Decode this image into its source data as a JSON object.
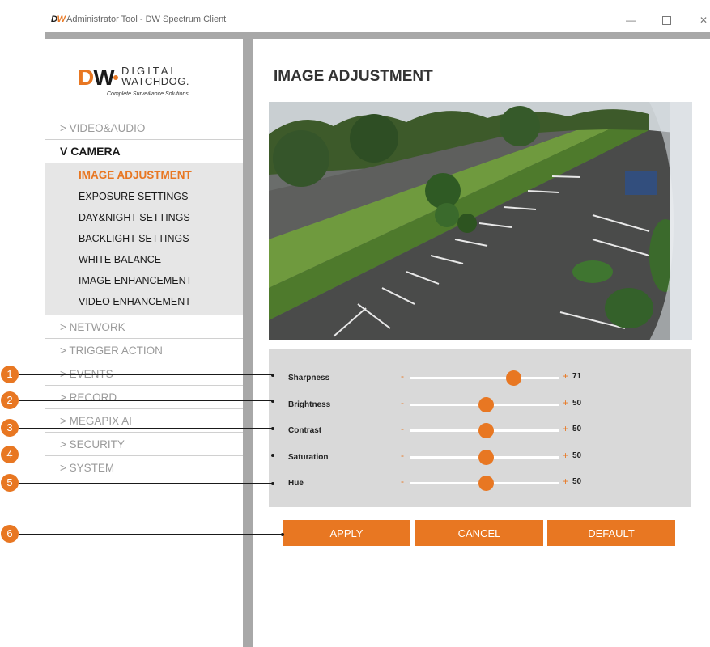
{
  "window": {
    "logo_a": "D",
    "logo_b": "W",
    "title": "Administrator Tool - DW Spectrum Client",
    "minimize": "—",
    "close": "✕"
  },
  "brand": {
    "mark_d": "D",
    "mark_w": "W",
    "line1": "DIGITAL",
    "line2": "WATCHDOG.",
    "tagline": "Complete Surveillance Solutions"
  },
  "menu": {
    "video_audio": "> VIDEO&AUDIO",
    "camera": "V CAMERA",
    "camera_items": [
      "IMAGE ADJUSTMENT",
      "EXPOSURE SETTINGS",
      "DAY&NIGHT SETTINGS",
      "BACKLIGHT SETTINGS",
      "WHITE BALANCE",
      "IMAGE ENHANCEMENT",
      "VIDEO ENHANCEMENT"
    ],
    "network": "> NETWORK",
    "trigger_action": "> TRIGGER ACTION",
    "events": "> EVENTS",
    "record": "> RECORD",
    "megapix_ai": "> MEGAPIX AI",
    "security": "> SECURITY",
    "system": "> SYSTEM"
  },
  "page": {
    "title": "IMAGE ADJUSTMENT"
  },
  "sliders": {
    "minus": "-",
    "plus": "+",
    "min": 0,
    "max": 100,
    "items": [
      {
        "label": "Sharpness",
        "value": "71"
      },
      {
        "label": "Brightness",
        "value": "50"
      },
      {
        "label": "Contrast",
        "value": "50"
      },
      {
        "label": "Saturation",
        "value": "50"
      },
      {
        "label": "Hue",
        "value": "50"
      }
    ]
  },
  "buttons": {
    "apply": "APPLY",
    "cancel": "CANCEL",
    "default": "DEFAULT"
  },
  "callouts": [
    "1",
    "2",
    "3",
    "4",
    "5",
    "6"
  ],
  "colors": {
    "accent": "#e87722",
    "panel": "#d9d9d9",
    "submenu_bg": "#e6e6e6"
  }
}
